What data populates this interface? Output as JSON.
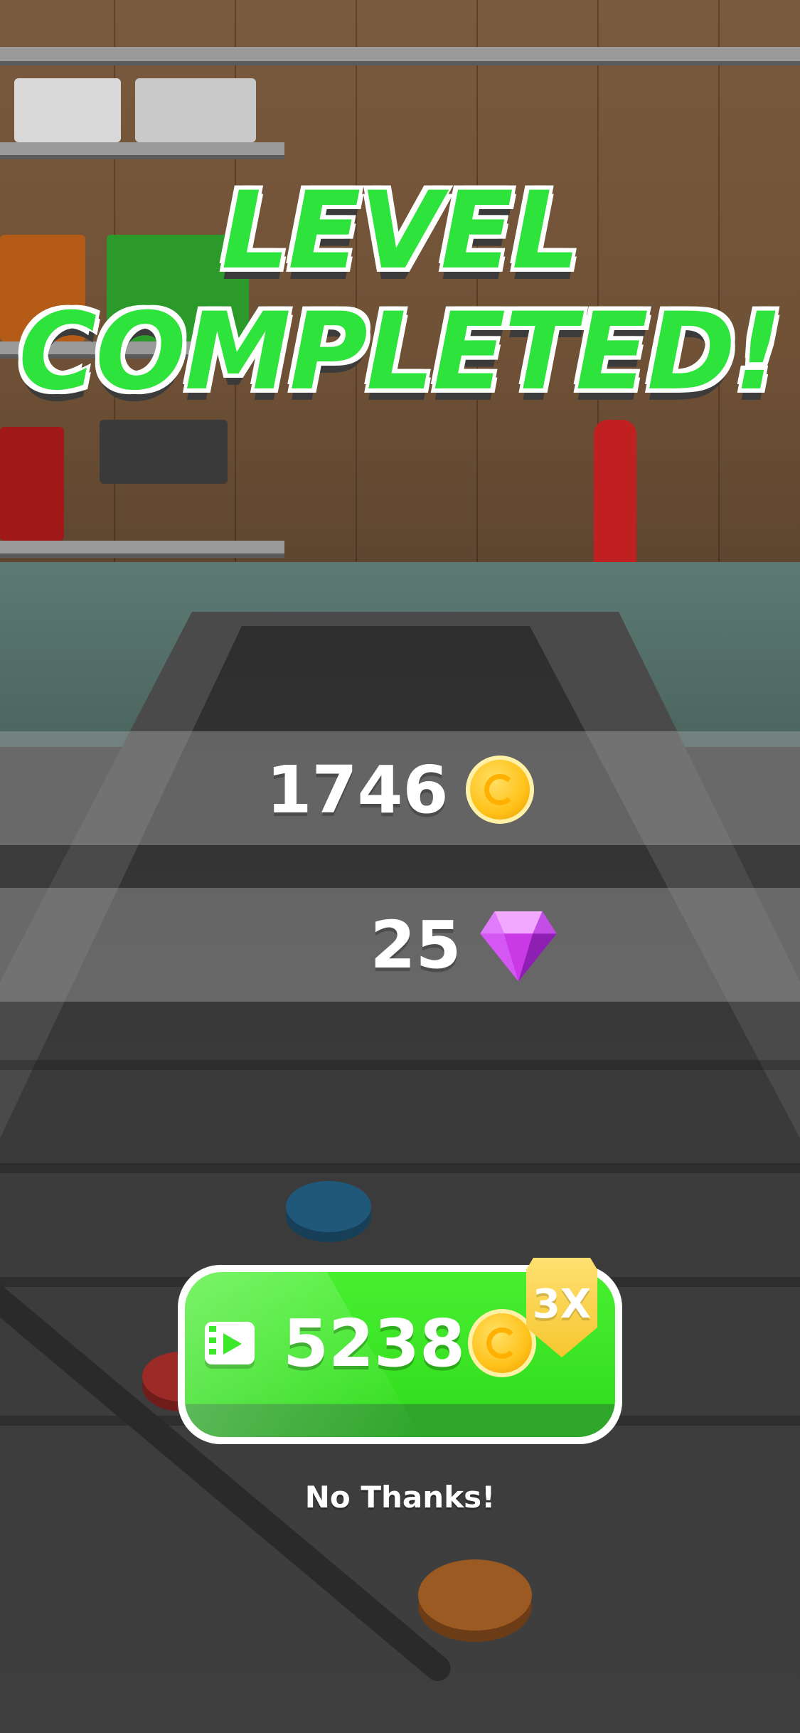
{
  "title": {
    "line1": "LEVEL",
    "line2": "COMPLETED!"
  },
  "rewards": {
    "coins": "1746",
    "gems": "25"
  },
  "cta": {
    "value": "5238",
    "badge": "3X"
  },
  "dismiss": {
    "label": "No Thanks!"
  },
  "colors": {
    "title_green": "#2ee33c",
    "cta_green": "#3ce92a",
    "badge_gold": "#f6c62f",
    "coin_gold": "#ffc21a",
    "gem_purple": "#c93ae6"
  },
  "icons": {
    "coin": "coin-icon",
    "gem": "gem-icon",
    "video": "video-ad-icon"
  }
}
